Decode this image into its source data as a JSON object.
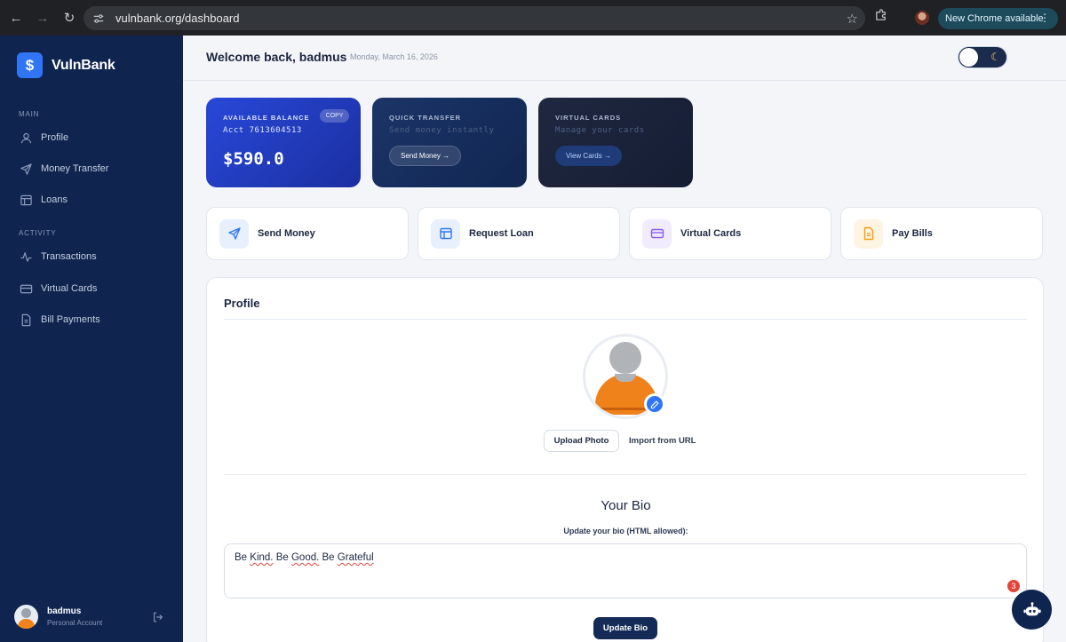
{
  "browser": {
    "url": "vulnbank.org/dashboard",
    "update_label": "New Chrome available"
  },
  "sidebar": {
    "brand": "VulnBank",
    "brand_symbol": "$",
    "sections": [
      {
        "label": "MAIN",
        "items": [
          {
            "label": "Profile",
            "icon": "user-icon"
          },
          {
            "label": "Money Transfer",
            "icon": "send-icon"
          },
          {
            "label": "Loans",
            "icon": "loan-icon"
          }
        ]
      },
      {
        "label": "ACTIVITY",
        "items": [
          {
            "label": "Transactions",
            "icon": "activity-icon"
          },
          {
            "label": "Virtual Cards",
            "icon": "card-icon"
          },
          {
            "label": "Bill Payments",
            "icon": "bill-icon"
          }
        ]
      }
    ],
    "user": {
      "name": "badmus",
      "role": "Personal Account"
    }
  },
  "header": {
    "welcome": "Welcome back, badmus",
    "date": "Monday, March 16, 2026"
  },
  "hero_cards": {
    "balance": {
      "label": "AVAILABLE BALANCE",
      "account": "Acct 7613604513",
      "amount": "$590.0",
      "copy": "COPY"
    },
    "transfer": {
      "label": "QUICK TRANSFER",
      "sub": "Send money instantly",
      "button": "Send Money →"
    },
    "cards": {
      "label": "VIRTUAL CARDS",
      "sub": "Manage your cards",
      "button": "View Cards →"
    }
  },
  "quick_actions": [
    {
      "label": "Send Money",
      "icon": "send-icon",
      "color": "#2f75f6"
    },
    {
      "label": "Request Loan",
      "icon": "loan-icon",
      "color": "#2f75f6"
    },
    {
      "label": "Virtual Cards",
      "icon": "card-icon",
      "color": "#8b5cf6"
    },
    {
      "label": "Pay Bills",
      "icon": "bill-icon",
      "color": "#f59e0b"
    }
  ],
  "profile": {
    "title": "Profile",
    "upload": "Upload Photo",
    "import": "Import from URL",
    "bio_title": "Your Bio",
    "bio_sub": "Update your bio (HTML allowed):",
    "bio_words": [
      "Be",
      "Kind.",
      "Be",
      "Good.",
      "Be",
      "Grateful"
    ],
    "update": "Update Bio"
  },
  "chat": {
    "badge": "3"
  },
  "colors": {
    "sidebar": "#0f2550",
    "accent": "#2f75f6",
    "primary_button": "#142a57"
  }
}
